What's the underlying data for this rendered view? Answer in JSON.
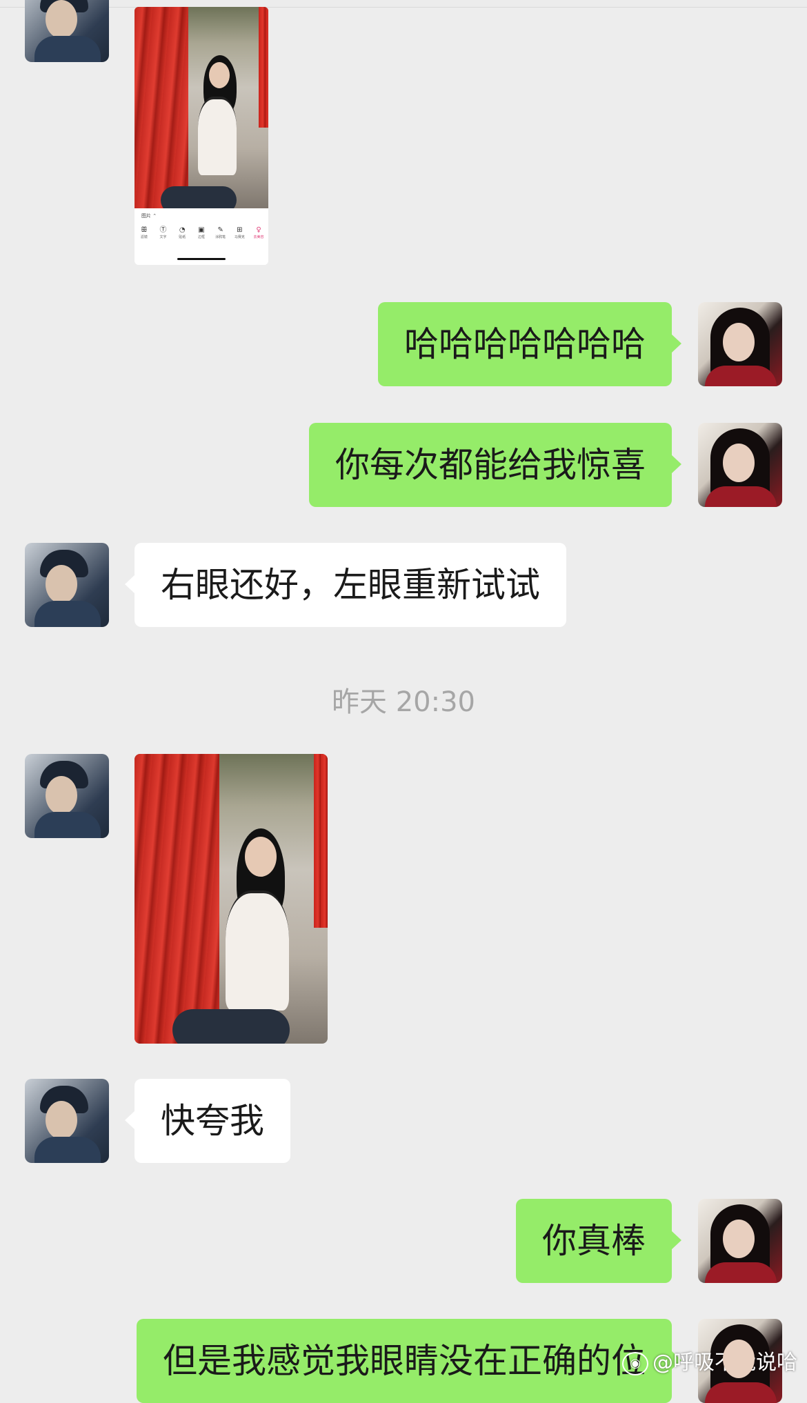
{
  "messages": [
    {
      "from": "friend",
      "kind": "image"
    },
    {
      "from": "self",
      "kind": "text",
      "text": "哈哈哈哈哈哈哈"
    },
    {
      "from": "self",
      "kind": "text",
      "text": "你每次都能给我惊喜"
    },
    {
      "from": "friend",
      "kind": "text",
      "text": "右眼还好，左眼重新试试"
    },
    {
      "kind": "timestamp",
      "text": "昨天 20:30"
    },
    {
      "from": "friend",
      "kind": "image"
    },
    {
      "from": "friend",
      "kind": "text",
      "text": "快夸我"
    },
    {
      "from": "self",
      "kind": "text",
      "text": "你真棒"
    },
    {
      "from": "self",
      "kind": "text",
      "text": "但是我感觉我眼睛没在正确的位"
    }
  ],
  "editor_screenshot": {
    "label": "图片 ⌃",
    "tools": [
      {
        "icon": "ꕥ",
        "label": "滤镜"
      },
      {
        "icon": "Ⓣ",
        "label": "文字"
      },
      {
        "icon": "◔",
        "label": "贴纸"
      },
      {
        "icon": "▣",
        "label": "边框"
      },
      {
        "icon": "✎",
        "label": "涂鸦笔"
      },
      {
        "icon": "⊞",
        "label": "马赛克"
      },
      {
        "icon": "♀",
        "label": "去美容"
      }
    ],
    "active_tool": "去美容"
  },
  "watermark": {
    "icon": "weibo-icon",
    "text": "@呼吸不能说哈"
  }
}
